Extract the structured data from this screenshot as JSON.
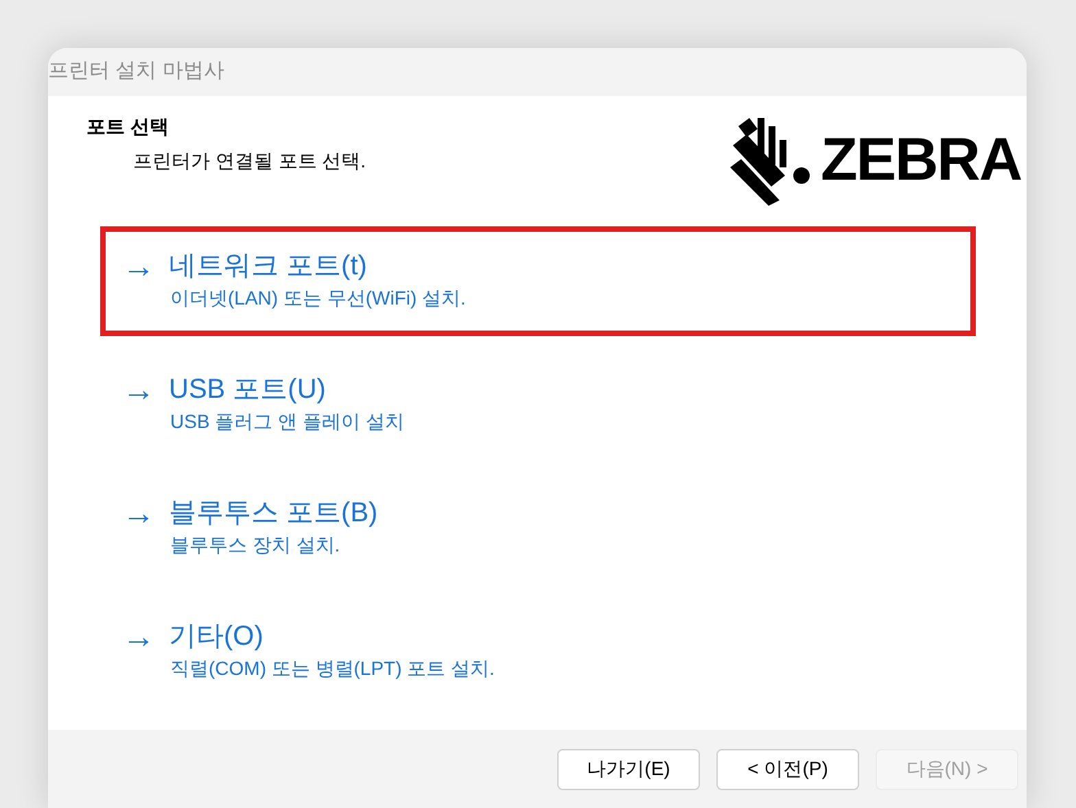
{
  "window": {
    "title": "프린터 설치 마법사"
  },
  "header": {
    "title": "포트 선택",
    "subtitle": "프린터가 연결될 포트 선택.",
    "logo": "ZEBRA"
  },
  "options": [
    {
      "arrow": "→",
      "label": "네트워크 포트(t)",
      "description": "이더넷(LAN) 또는 무선(WiFi) 설치.",
      "selected": true
    },
    {
      "arrow": "→",
      "label": "USB 포트(U)",
      "description": "USB 플러그 앤 플레이 설치",
      "selected": false
    },
    {
      "arrow": "→",
      "label": "블루투스 포트(B)",
      "description": "블루투스 장치 설치.",
      "selected": false
    },
    {
      "arrow": "→",
      "label": "기타(O)",
      "description": "직렬(COM) 또는 병렬(LPT) 포트 설치.",
      "selected": false
    }
  ],
  "buttons": [
    {
      "label": "나가기(E)",
      "disabled": false
    },
    {
      "label": "< 이전(P)",
      "disabled": false
    },
    {
      "label": "다음(N) >",
      "disabled": true
    }
  ]
}
